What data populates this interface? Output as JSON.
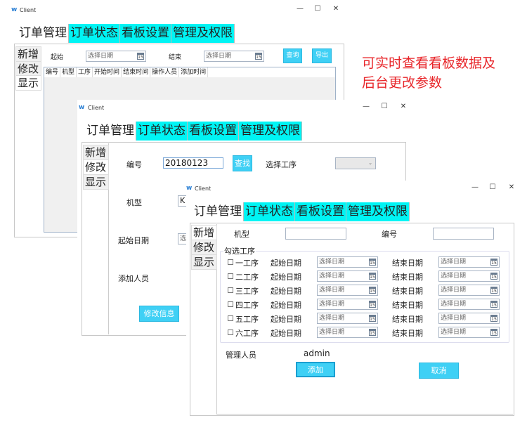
{
  "app_title": "Client",
  "window_controls": {
    "minimize": "—",
    "maximize": "☐",
    "close": "✕"
  },
  "tabs": [
    "订单管理",
    "订单状态",
    "看板设置",
    "管理及权限"
  ],
  "side": [
    "新增",
    "修改",
    "显示"
  ],
  "note": [
    "可实时查看看板数据及",
    "后台更改参数"
  ],
  "colors": {
    "tab_accent": "#00f4f4",
    "button": "#3fd0f5",
    "note": "#e8262a"
  },
  "w1": {
    "start_label": "起始",
    "end_label": "结束",
    "date_placeholder": "选择日期",
    "query": "查询",
    "export": "导出",
    "columns": [
      "编号",
      "机型",
      "工序",
      "开始时间",
      "结束时间",
      "操作人员",
      "添加时间"
    ]
  },
  "w2": {
    "id_label": "编号",
    "id_value": "20180123",
    "find": "查找",
    "process_label": "选择工序",
    "model_label": "机型",
    "model_value": "K",
    "start_label": "起始日期",
    "start_value": "选",
    "adder_label": "添加人员",
    "modify": "修改信息"
  },
  "w3": {
    "model_label": "机型",
    "id_label": "编号",
    "group_label": "勾选工序",
    "rows": [
      {
        "name": "一工序"
      },
      {
        "name": "二工序"
      },
      {
        "name": "三工序"
      },
      {
        "name": "四工序"
      },
      {
        "name": "五工序"
      },
      {
        "name": "六工序"
      }
    ],
    "start_label": "起始日期",
    "end_label": "结束日期",
    "date_placeholder": "选择日期",
    "cal_icon": "15",
    "manager_label": "管理人员",
    "manager_value": "admin",
    "add": "添加",
    "cancel": "取消"
  }
}
